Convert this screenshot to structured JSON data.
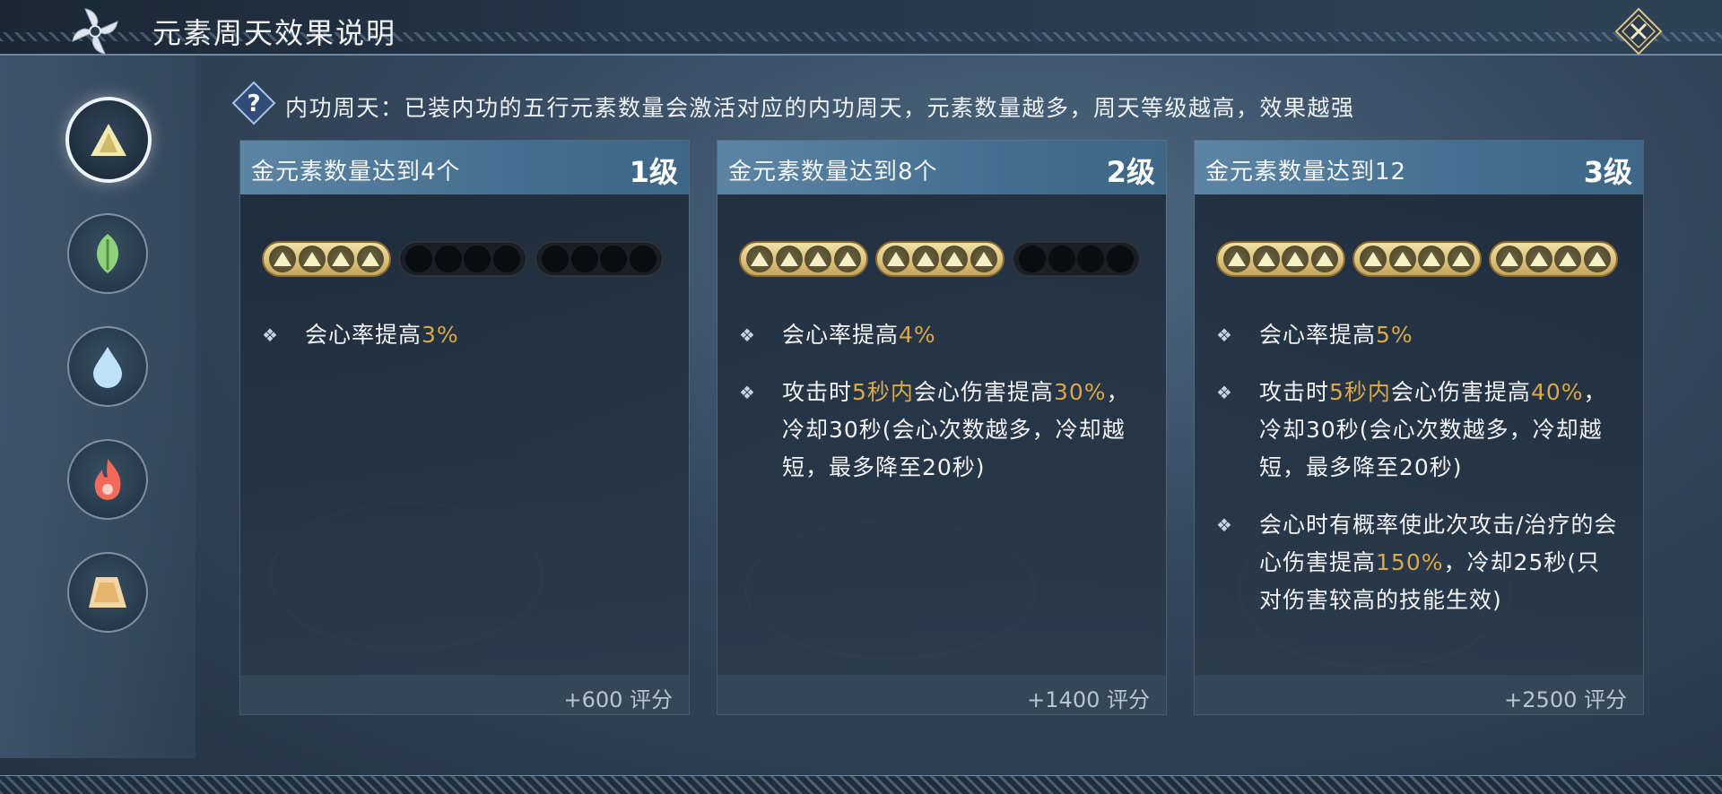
{
  "header": {
    "title": "元素周天效果说明"
  },
  "info": {
    "text": "内功周天：已装内功的五行元素数量会激活对应的内功周天，元素数量越多，周天等级越高，效果越强"
  },
  "sidebar": {
    "elements": [
      {
        "name": "metal",
        "icon": "metal-triangle-icon",
        "active": true
      },
      {
        "name": "wood",
        "icon": "leaf-icon",
        "active": false
      },
      {
        "name": "water",
        "icon": "water-drop-icon",
        "active": false
      },
      {
        "name": "fire",
        "icon": "flame-icon",
        "active": false
      },
      {
        "name": "earth",
        "icon": "earth-rock-icon",
        "active": false
      }
    ]
  },
  "colors": {
    "highlight": "#d9a94b",
    "card_header": "#4f7a99"
  },
  "cards": [
    {
      "condition": "金元素数量达到4个",
      "level": "1级",
      "filled_groups": 1,
      "effects": [
        {
          "text": [
            {
              "t": "会心率提高"
            },
            {
              "t": "3%",
              "hl": true
            }
          ]
        }
      ],
      "score": "+600 评分"
    },
    {
      "condition": "金元素数量达到8个",
      "level": "2级",
      "filled_groups": 2,
      "effects": [
        {
          "text": [
            {
              "t": "会心率提高"
            },
            {
              "t": "4%",
              "hl": true
            }
          ]
        },
        {
          "text": [
            {
              "t": "攻击时"
            },
            {
              "t": "5秒内",
              "hl": true
            },
            {
              "t": "会心伤害提高"
            },
            {
              "t": "30%",
              "hl": true
            },
            {
              "t": "，冷却30秒(会心次数越多，冷却越短，最多降至20秒)"
            }
          ]
        }
      ],
      "score": "+1400 评分"
    },
    {
      "condition": "金元素数量达到12",
      "level": "3级",
      "filled_groups": 3,
      "effects": [
        {
          "text": [
            {
              "t": "会心率提高"
            },
            {
              "t": "5%",
              "hl": true
            }
          ]
        },
        {
          "text": [
            {
              "t": "攻击时"
            },
            {
              "t": "5秒内",
              "hl": true
            },
            {
              "t": "会心伤害提高"
            },
            {
              "t": "40%",
              "hl": true
            },
            {
              "t": "，冷却30秒(会心次数越多，冷却越短，最多降至20秒)"
            }
          ]
        },
        {
          "text": [
            {
              "t": "会心时有概率使此次攻击/治疗的会心伤害提高"
            },
            {
              "t": "150%",
              "hl": true
            },
            {
              "t": "，冷却25秒(只对伤害较高的技能生效)"
            }
          ]
        }
      ],
      "score": "+2500 评分"
    }
  ]
}
